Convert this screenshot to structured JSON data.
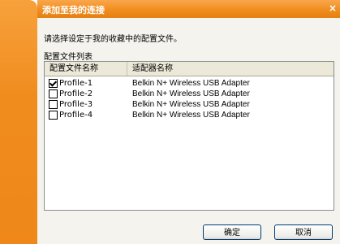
{
  "dialog": {
    "title": "添加至我的连接",
    "close_glyph": "×",
    "instruction": "请选择设定于我的收藏中的配置文件。",
    "list_label": "配置文件列表"
  },
  "table": {
    "columns": [
      "配置文件名称",
      "适配器名称"
    ],
    "rows": [
      {
        "profile": "Profile-1",
        "adapter": "Belkin N+ Wireless USB Adapter",
        "checked": true
      },
      {
        "profile": "Profile-2",
        "adapter": "Belkin N+ Wireless USB Adapter",
        "checked": false
      },
      {
        "profile": "Profile-3",
        "adapter": "Belkin N+ Wireless USB Adapter",
        "checked": false
      },
      {
        "profile": "Profile-4",
        "adapter": "Belkin N+ Wireless USB Adapter",
        "checked": false
      }
    ]
  },
  "buttons": {
    "ok": "确定",
    "cancel": "取消"
  },
  "colors": {
    "accent": "#f08c1e",
    "dialog_bg": "#f4f3ee"
  }
}
